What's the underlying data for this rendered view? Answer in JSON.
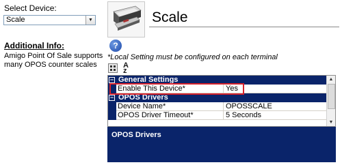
{
  "device_selector": {
    "label": "Select Device:",
    "selected": "Scale"
  },
  "info": {
    "heading": "Additional Info:",
    "text": "Amigo Point Of Sale supports many OPOS counter scales"
  },
  "header": {
    "title": "Scale",
    "note": "*Local Setting must be configured on each terminal",
    "help_glyph": "?"
  },
  "toolbar": {
    "sort_glyph_top": "A",
    "sort_glyph_bottom": "z"
  },
  "property_grid": {
    "categories": [
      {
        "label": "General Settings",
        "properties": [
          {
            "name": "Enable This Device*",
            "value": "Yes"
          }
        ]
      },
      {
        "label": "OPOS Drivers",
        "properties": [
          {
            "name": "Device Name*",
            "value": "OPOSSCALE"
          },
          {
            "name": "OPOS Driver Timeout*",
            "value": "5 Seconds"
          }
        ]
      }
    ],
    "toggle_glyph": "−"
  },
  "description": {
    "title": "OPOS Drivers"
  },
  "colors": {
    "category_bg": "#0a246a",
    "highlight": "#d6202a"
  }
}
